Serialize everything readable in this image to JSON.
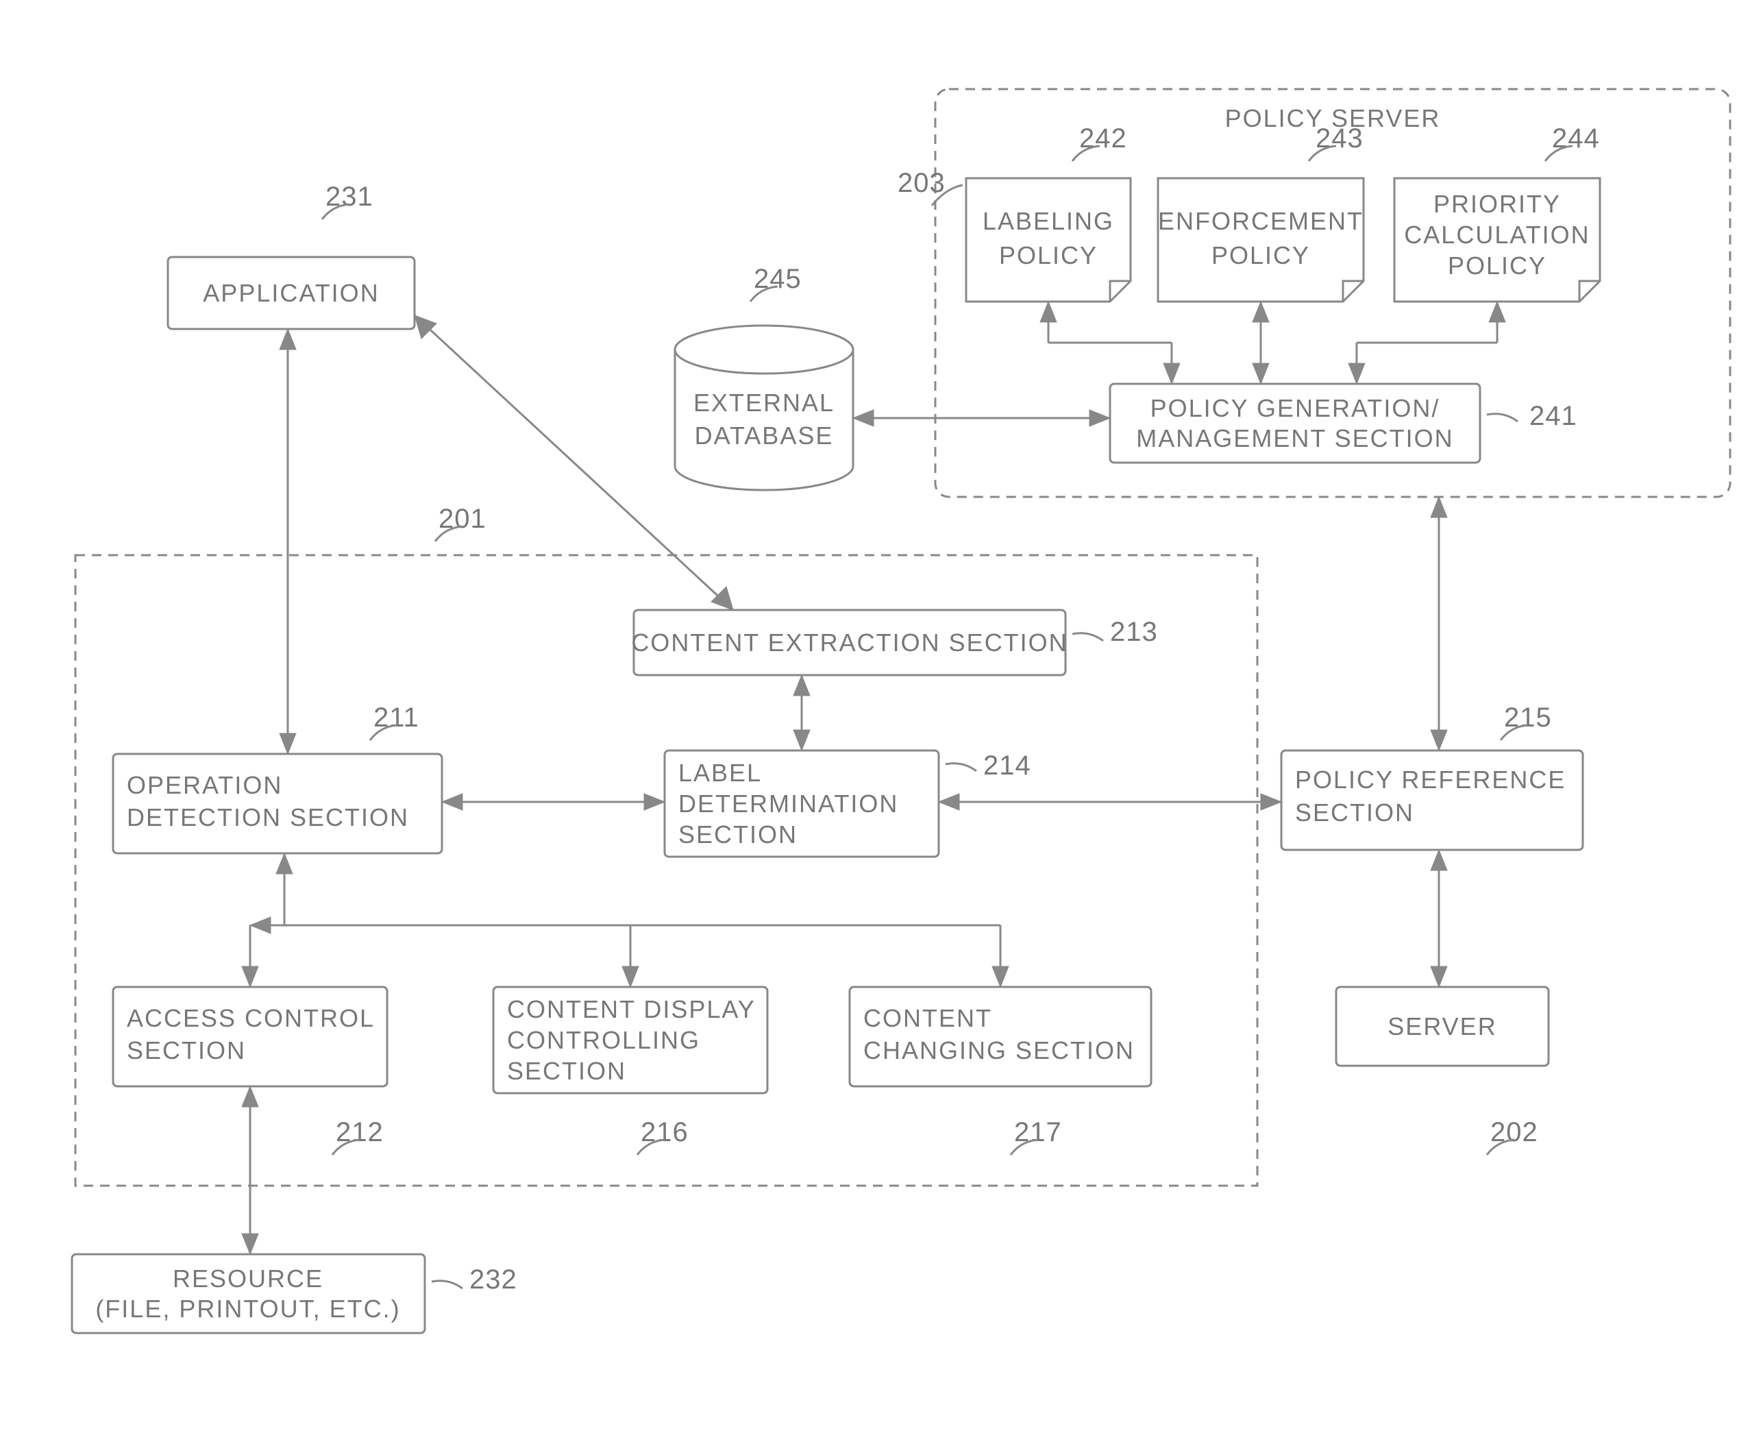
{
  "nodes": {
    "application": {
      "ref": "231",
      "label": "APPLICATION"
    },
    "external_db": {
      "ref": "245",
      "label1": "EXTERNAL",
      "label2": "DATABASE"
    },
    "policy_server": {
      "ref": "203",
      "title": "POLICY SERVER",
      "labeling": {
        "ref": "242",
        "l1": "LABELING",
        "l2": "POLICY"
      },
      "enforcement": {
        "ref": "243",
        "l1": "ENFORCEMENT",
        "l2": "POLICY"
      },
      "priority": {
        "ref": "244",
        "l1": "PRIORITY",
        "l2": "CALCULATION",
        "l3": "POLICY"
      },
      "mgmt": {
        "ref": "241",
        "l1": "POLICY GENERATION/",
        "l2": "MANAGEMENT SECTION"
      }
    },
    "main": {
      "ref": "201",
      "content_extraction": {
        "ref": "213",
        "l1": "CONTENT EXTRACTION SECTION"
      },
      "operation_detection": {
        "ref": "211",
        "l1": "OPERATION",
        "l2": "DETECTION SECTION"
      },
      "label_determination": {
        "ref": "214",
        "l1": "LABEL",
        "l2": "DETERMINATION",
        "l3": "SECTION"
      },
      "policy_reference": {
        "ref": "215",
        "l1": "POLICY REFERENCE",
        "l2": "SECTION"
      },
      "access_control": {
        "ref": "212",
        "l1": "ACCESS CONTROL",
        "l2": "SECTION"
      },
      "content_display": {
        "ref": "216",
        "l1": "CONTENT DISPLAY",
        "l2": "CONTROLLING",
        "l3": "SECTION"
      },
      "content_changing": {
        "ref": "217",
        "l1": "CONTENT",
        "l2": "CHANGING SECTION"
      }
    },
    "server": {
      "ref": "202",
      "label": "SERVER"
    },
    "resource": {
      "ref": "232",
      "l1": "RESOURCE",
      "l2": "(FILE, PRINTOUT, ETC.)"
    }
  }
}
